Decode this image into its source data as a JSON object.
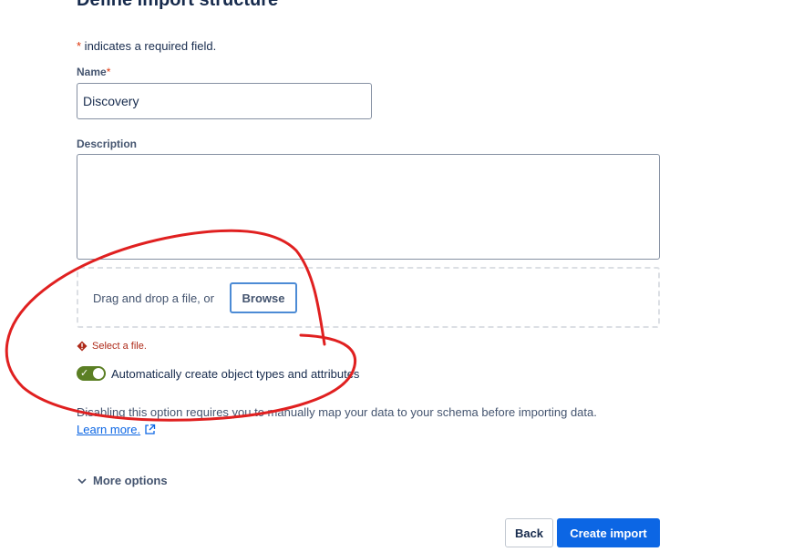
{
  "page": {
    "title": "Define import structure"
  },
  "required_note": {
    "star": "*",
    "text": " indicates a required field."
  },
  "name_field": {
    "label": "Name",
    "required_star": "*",
    "value": "Discovery"
  },
  "description_field": {
    "label": "Description",
    "value": ""
  },
  "file_drop": {
    "text": "Drag and drop a file, or",
    "browse_label": "Browse"
  },
  "error": {
    "message": "Select a file.",
    "color": "#ae2a19"
  },
  "auto_create": {
    "label": "Automatically create object types and attributes",
    "enabled": true,
    "help_text": "Disabling this option requires you to manually map your data to your schema before importing data.",
    "learn_more": "Learn more."
  },
  "more_options": {
    "label": "More options"
  },
  "actions": {
    "back_label": "Back",
    "create_label": "Create import"
  },
  "colors": {
    "primary": "#0c66e4",
    "toggle_on": "#5b7f24",
    "error": "#ae2a19",
    "annotation": "#e02020"
  }
}
